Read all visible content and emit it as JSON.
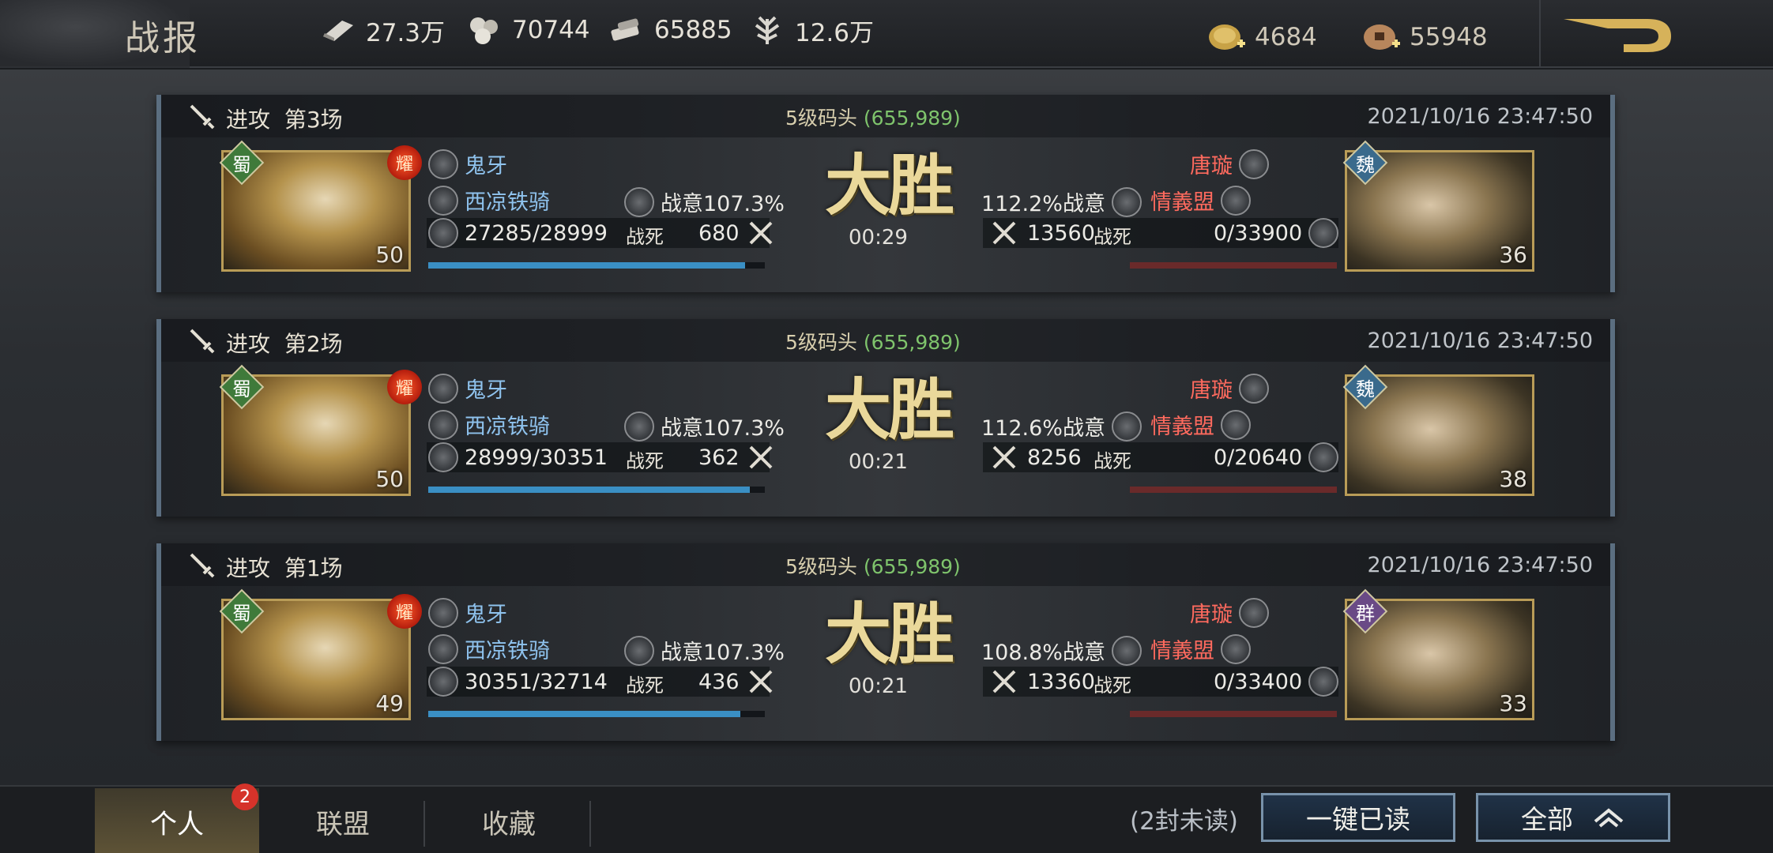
{
  "header": {
    "title": "战报",
    "resources": [
      {
        "icon": "wood-icon",
        "value": "27.3万"
      },
      {
        "icon": "iron-icon",
        "value": "70744"
      },
      {
        "icon": "stone-icon",
        "value": "65885"
      },
      {
        "icon": "grain-icon",
        "value": "12.6万"
      }
    ],
    "currencies": [
      {
        "icon": "gold-coin-plus-icon",
        "value": "4684"
      },
      {
        "icon": "copper-coin-plus-icon",
        "value": "55948"
      }
    ]
  },
  "reports": [
    {
      "type_label": "进攻",
      "round_label": "第3场",
      "location": "5级码头",
      "coords": "(655,989)",
      "timestamp": "2021/10/16 23:47:50",
      "result": "大胜",
      "duration": "00:29",
      "attacker": {
        "faction": "蜀",
        "level": "50",
        "name": "鬼牙",
        "troop": "西凉铁骑",
        "morale": "战意107.3%",
        "troops": "27285/28999",
        "dead_label": "战死",
        "dead": "680",
        "hp_ratio": 0.941
      },
      "defender": {
        "faction": "魏",
        "level": "36",
        "name": "唐璇",
        "alliance": "情義盟",
        "morale": "112.2%战意",
        "troops": "0/33900",
        "dead_label": "战死",
        "dead": "13560",
        "hp_ratio": 0
      }
    },
    {
      "type_label": "进攻",
      "round_label": "第2场",
      "location": "5级码头",
      "coords": "(655,989)",
      "timestamp": "2021/10/16 23:47:50",
      "result": "大胜",
      "duration": "00:21",
      "attacker": {
        "faction": "蜀",
        "level": "50",
        "name": "鬼牙",
        "troop": "西凉铁骑",
        "morale": "战意107.3%",
        "troops": "28999/30351",
        "dead_label": "战死",
        "dead": "362",
        "hp_ratio": 0.955
      },
      "defender": {
        "faction": "魏",
        "level": "38",
        "name": "唐璇",
        "alliance": "情義盟",
        "morale": "112.6%战意",
        "troops": "0/20640",
        "dead_label": "战死",
        "dead": "8256",
        "hp_ratio": 0
      }
    },
    {
      "type_label": "进攻",
      "round_label": "第1场",
      "location": "5级码头",
      "coords": "(655,989)",
      "timestamp": "2021/10/16 23:47:50",
      "result": "大胜",
      "duration": "00:21",
      "attacker": {
        "faction": "蜀",
        "level": "49",
        "name": "鬼牙",
        "troop": "西凉铁骑",
        "morale": "战意107.3%",
        "troops": "30351/32714",
        "dead_label": "战死",
        "dead": "436",
        "hp_ratio": 0.928
      },
      "defender": {
        "faction": "群",
        "level": "33",
        "name": "唐璇",
        "alliance": "情義盟",
        "morale": "108.8%战意",
        "troops": "0/33400",
        "dead_label": "战死",
        "dead": "13360",
        "hp_ratio": 0
      }
    }
  ],
  "badge_yao": "耀",
  "footer": {
    "tabs": [
      {
        "label": "个人",
        "active": true
      },
      {
        "label": "联盟",
        "active": false
      },
      {
        "label": "收藏",
        "active": false
      }
    ],
    "notification_count": "2",
    "unread_text": "(2封未读)",
    "read_all_label": "一键已读",
    "filter_label": "全部"
  },
  "colors": {
    "accent_gold": "#ead89a",
    "attacker_blue": "#8fc3ee",
    "defender_red": "#ff6a5e",
    "coords_green": "#7fc46c",
    "button_border": "#7892aa"
  }
}
